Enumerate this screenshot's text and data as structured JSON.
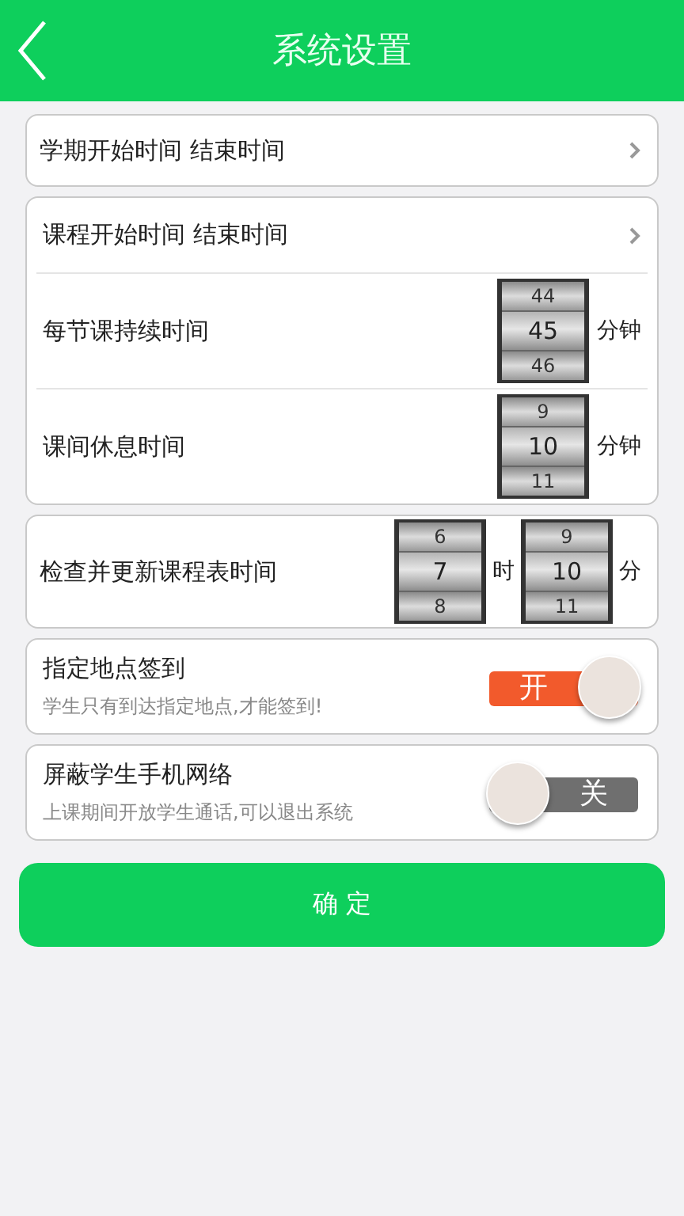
{
  "header": {
    "title": "系统设置"
  },
  "semester_row": {
    "label": "学期开始时间 结束时间"
  },
  "class_card": {
    "time_row": {
      "label": "课程开始时间 结束时间"
    },
    "pickers": [
      {
        "label": "每节课持续时间",
        "values": [
          "44",
          "45",
          "46"
        ],
        "unit": "分钟"
      },
      {
        "label": "课间休息时间",
        "values": [
          "9",
          "10",
          "11"
        ],
        "unit": "分钟"
      }
    ]
  },
  "update_row": {
    "label": "检查并更新课程表时间",
    "wheels": [
      {
        "values": [
          "6",
          "7",
          "8"
        ],
        "unit": "时"
      },
      {
        "values": [
          "9",
          "10",
          "11"
        ],
        "unit": "分"
      }
    ]
  },
  "toggles": [
    {
      "title": "指定地点签到",
      "description": "学生只有到达指定地点,才能签到!",
      "on": true,
      "state_label": "开"
    },
    {
      "title": "屏蔽学生手机网络",
      "description": "上课期间开放学生通话,可以退出系统",
      "on": false,
      "state_label": "关"
    }
  ],
  "confirm_button": "确 定"
}
